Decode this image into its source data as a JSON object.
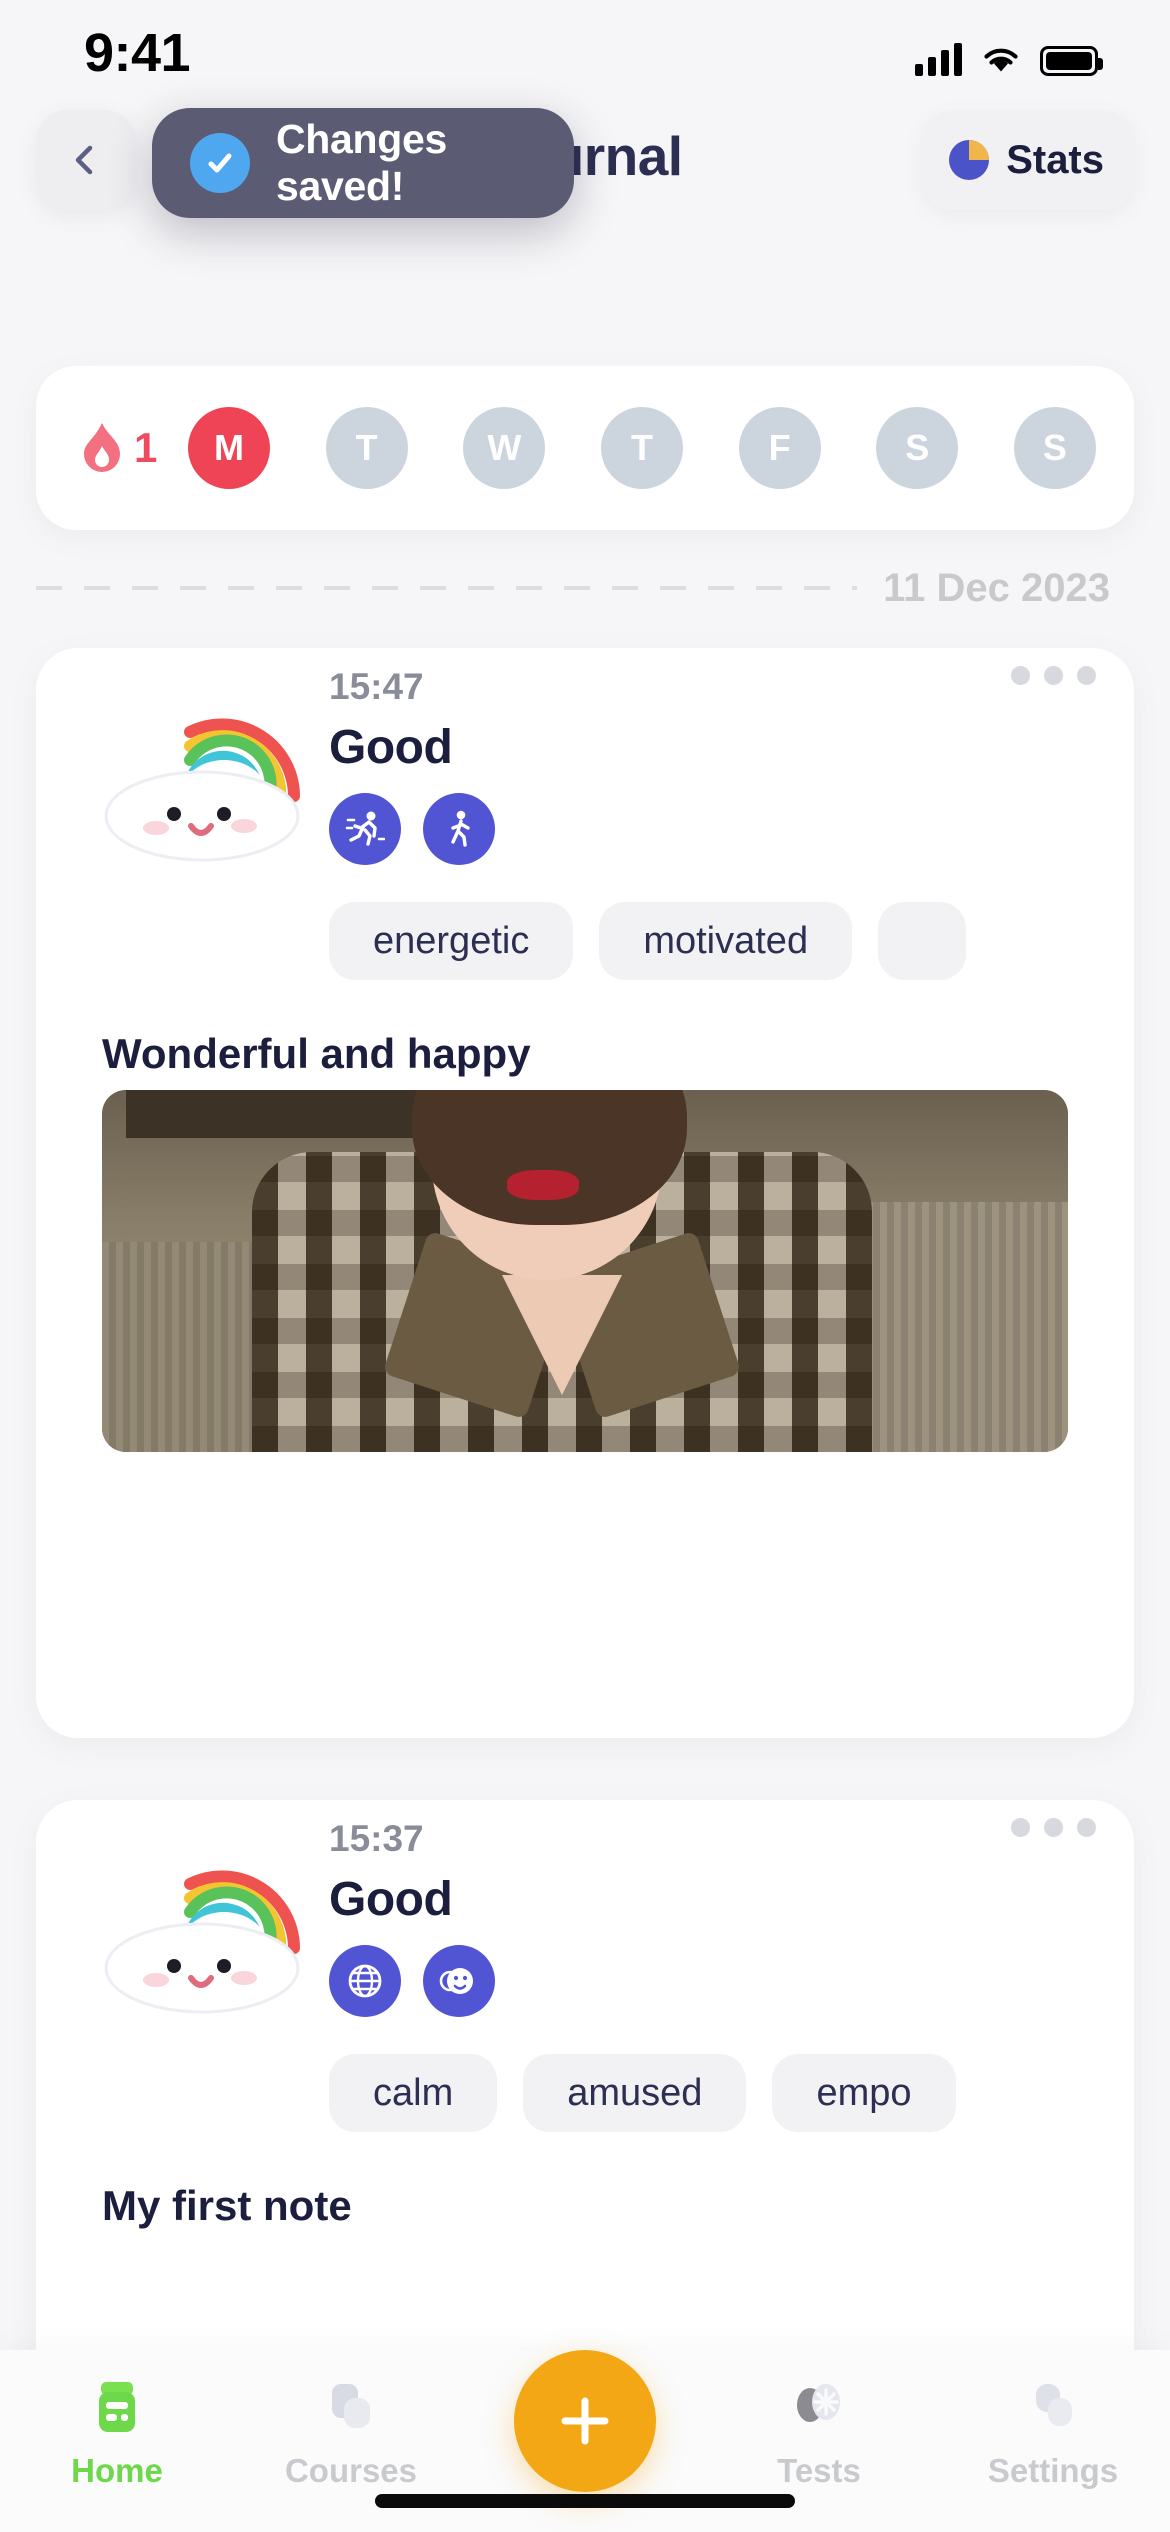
{
  "status_bar": {
    "time": "9:41",
    "signal_icon": "cellular-bars-icon",
    "wifi_icon": "wifi-icon",
    "battery_icon": "battery-full-icon"
  },
  "header": {
    "back_icon": "chevron-left-icon",
    "title": "Journal",
    "stats_label": "Stats",
    "stats_icon": "pie-chart-icon"
  },
  "toast": {
    "message": "Changes saved!",
    "icon": "check-circle-icon",
    "background_color": "#5b5c73",
    "icon_color": "#4fa7ef"
  },
  "week_strip": {
    "streak_icon": "flame-icon",
    "streak_count": "1",
    "streak_color": "#ef4b5e",
    "days": [
      {
        "label": "M",
        "active": true
      },
      {
        "label": "T",
        "active": false
      },
      {
        "label": "W",
        "active": false
      },
      {
        "label": "T",
        "active": false
      },
      {
        "label": "F",
        "active": false
      },
      {
        "label": "S",
        "active": false
      },
      {
        "label": "S",
        "active": false
      }
    ],
    "active_color": "#ef4455",
    "inactive_color": "#ccd4de"
  },
  "date_divider": {
    "label": "11 Dec 2023"
  },
  "entries": [
    {
      "time": "15:47",
      "mood": "Good",
      "mood_art": "cloud-rainbow-icon",
      "menu_icon": "more-dots-icon",
      "activities": [
        "running-icon",
        "walking-icon"
      ],
      "tags": [
        "energetic",
        "motivated",
        ""
      ],
      "note": "Wonderful and happy",
      "photo": "portrait-photo"
    },
    {
      "time": "15:37",
      "mood": "Good",
      "mood_art": "cloud-rainbow-icon",
      "menu_icon": "more-dots-icon",
      "activities": [
        "globe-www-icon",
        "smiley-face-icon"
      ],
      "tags": [
        "calm",
        "amused",
        "empo"
      ],
      "note": "My first note"
    }
  ],
  "tab_bar": {
    "items": [
      {
        "label": "Home",
        "icon": "book-icon",
        "active": true
      },
      {
        "label": "Courses",
        "icon": "cards-icon",
        "active": false
      },
      {
        "label": "Tests",
        "icon": "test-icon",
        "active": false
      },
      {
        "label": "Settings",
        "icon": "gear-icon",
        "active": false
      }
    ],
    "fab_icon": "plus-icon",
    "fab_color": "#f3a714",
    "active_color": "#6dd84a",
    "inactive_color": "#c9cace"
  }
}
